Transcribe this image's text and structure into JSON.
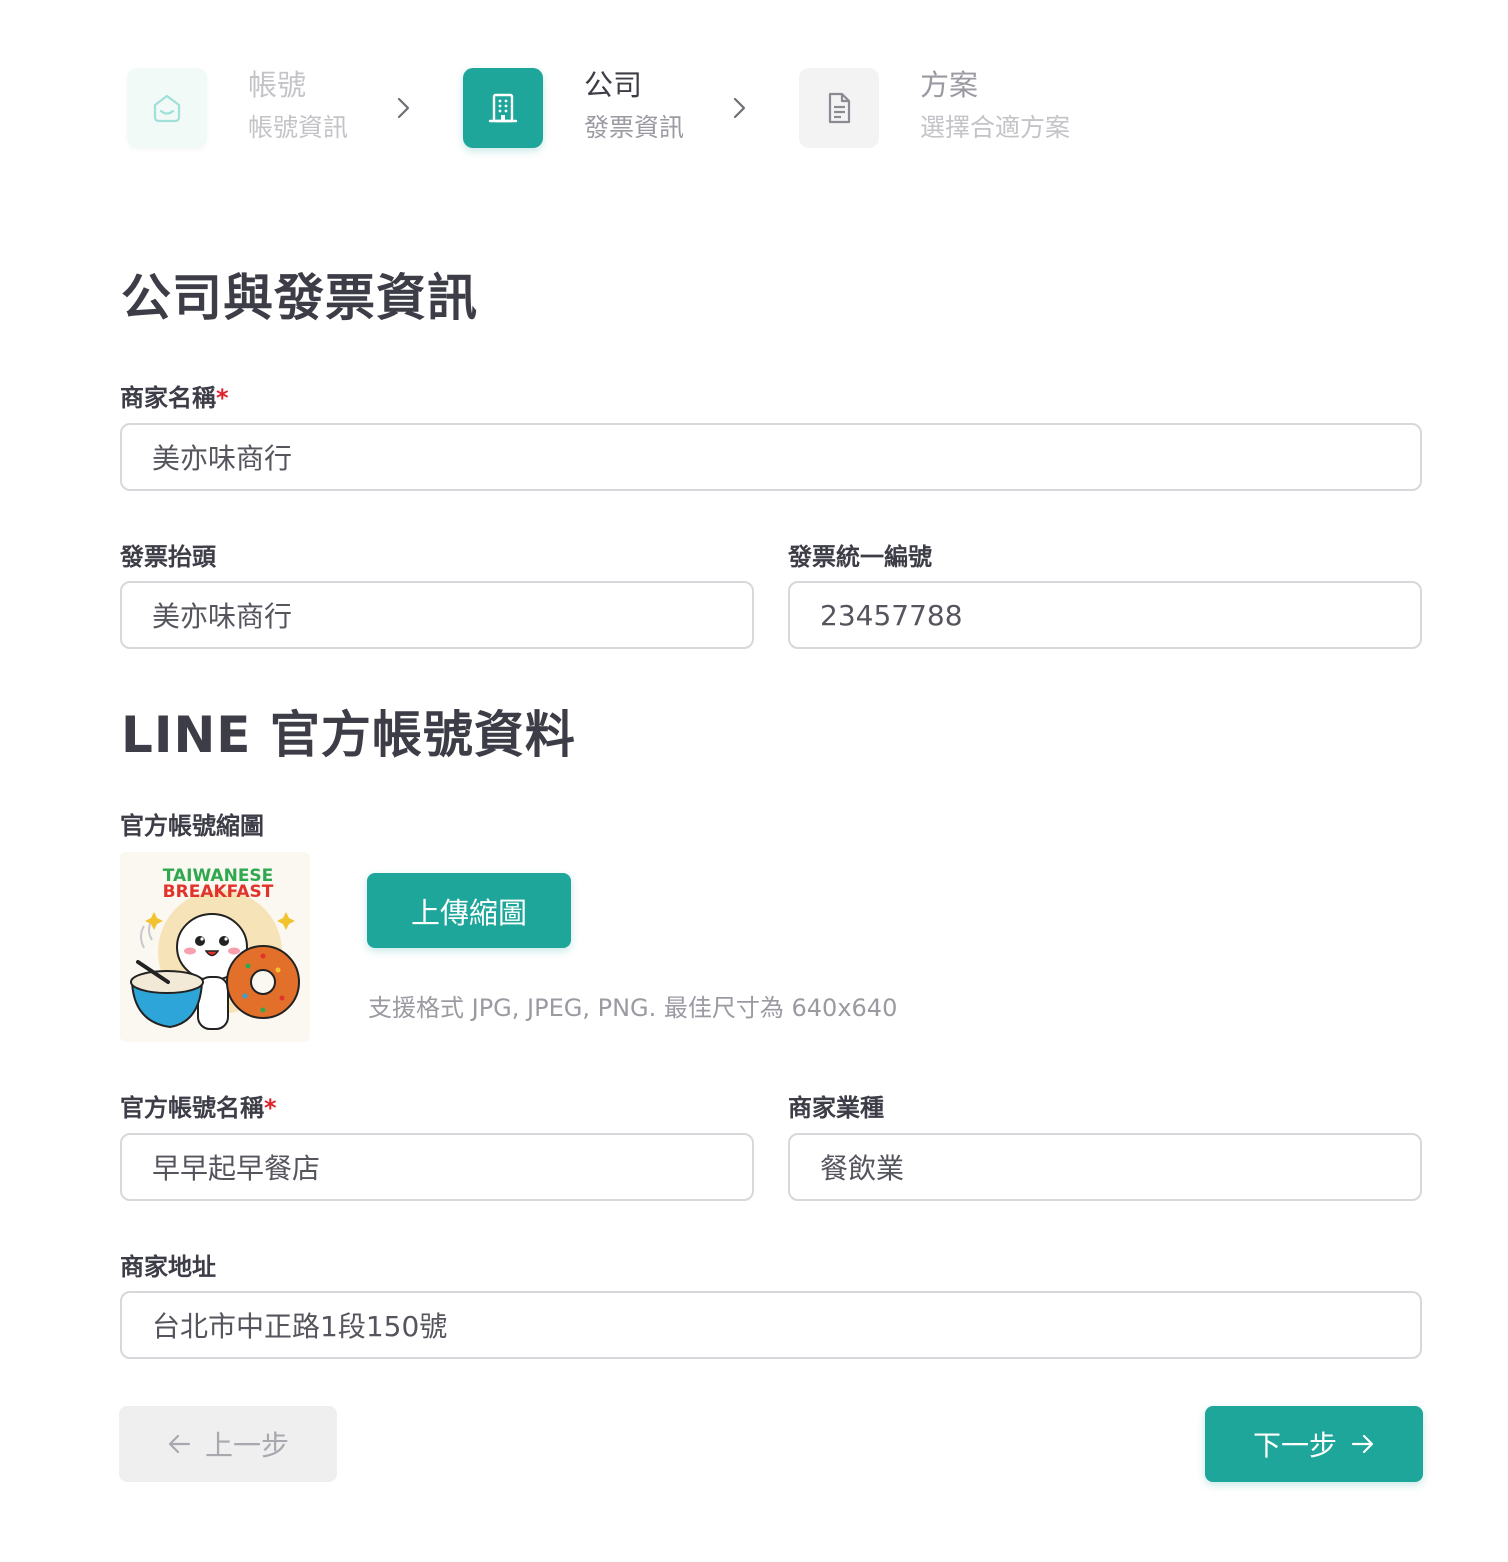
{
  "stepper": {
    "steps": [
      {
        "title": "帳號",
        "subtitle": "帳號資訊",
        "icon": "account-icon",
        "state": "completed"
      },
      {
        "title": "公司",
        "subtitle": "發票資訊",
        "icon": "building-icon",
        "state": "active"
      },
      {
        "title": "方案",
        "subtitle": "選擇合適方案",
        "icon": "document-icon",
        "state": "pending"
      }
    ]
  },
  "company_section": {
    "title": "公司與發票資訊",
    "merchant_name": {
      "label": "商家名稱",
      "required_mark": "*",
      "value": "美亦味商行"
    },
    "invoice_title": {
      "label": "發票抬頭",
      "value": "美亦味商行"
    },
    "tax_id": {
      "label": "發票統一編號",
      "value": "23457788"
    }
  },
  "line_section": {
    "title": "LINE 官方帳號資料",
    "thumbnail": {
      "label": "官方帳號縮圖",
      "image_text_line1": "TAIWANESE",
      "image_text_line2": "BREAKFAST",
      "upload_button": "上傳縮圖",
      "hint": "支援格式 JPG, JPEG, PNG. 最佳尺寸為 640x640"
    },
    "oa_name": {
      "label": "官方帳號名稱",
      "required_mark": "*",
      "value": "早早起早餐店"
    },
    "industry": {
      "label": "商家業種",
      "value": "餐飲業"
    },
    "address": {
      "label": "商家地址",
      "value": "台北市中正路1段150號"
    }
  },
  "nav": {
    "prev_label": "上一步",
    "next_label": "下一步"
  },
  "colors": {
    "accent": "#1ea69b",
    "required": "#e0202b",
    "text": "#3d3d47",
    "muted": "#9a9aa2"
  }
}
